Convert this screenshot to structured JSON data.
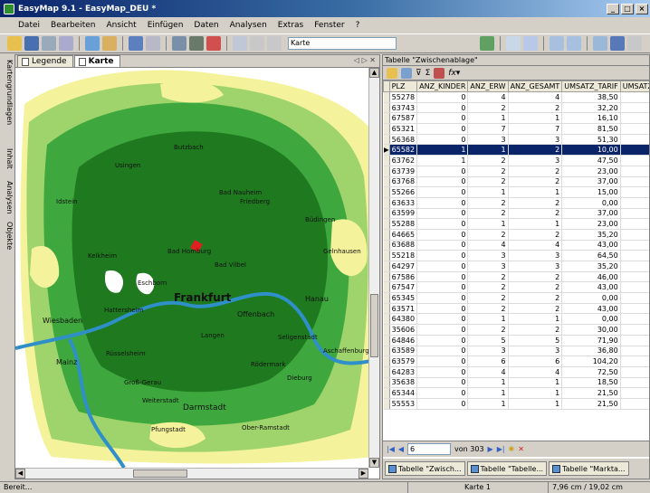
{
  "window": {
    "title": "EasyMap 9.1 - EasyMap_DEU *"
  },
  "menu": [
    "Datei",
    "Bearbeiten",
    "Ansicht",
    "Einfügen",
    "Daten",
    "Analysen",
    "Extras",
    "Fenster",
    "?"
  ],
  "toolbar": {
    "map_select": "Karte"
  },
  "left_tabs": [
    "Kartengrundlagen",
    "Inhalt",
    "Analysen",
    "Objekte"
  ],
  "map_tabs": [
    "Legende",
    "Karte"
  ],
  "map": {
    "labels": [
      "Frankfurt",
      "Offenbach",
      "Darmstadt",
      "Bad Homburg",
      "Bad Vilbel",
      "Bad Nauheim",
      "Friedberg",
      "Wiesbaden",
      "Mainz",
      "Rüsselsheim",
      "Hanau",
      "Butzbach",
      "Büdingen",
      "Eschborn",
      "Rödermark",
      "Dieburg",
      "Pfungstadt",
      "Groß-Gerau",
      "Aschaffenburg",
      "Langen",
      "Kelkheim",
      "Idstein",
      "Usingen",
      "Gelnhausen",
      "Seligenstadt",
      "Ober-Ramstadt",
      "Weiterstadt",
      "Hattersheim"
    ]
  },
  "table": {
    "panel_title": "Tabelle \"Zwischenablage\"",
    "columns": [
      "PLZ",
      "ANZ_KINDER",
      "ANZ_ERW",
      "ANZ_GESAMT",
      "UMSATZ_TARIF",
      "UMSATZ_"
    ],
    "rows": [
      [
        "55278",
        "0",
        "4",
        "4",
        "38,50"
      ],
      [
        "63743",
        "0",
        "2",
        "2",
        "32,20"
      ],
      [
        "67587",
        "0",
        "1",
        "1",
        "16,10"
      ],
      [
        "65321",
        "0",
        "7",
        "7",
        "81,50"
      ],
      [
        "56368",
        "0",
        "3",
        "3",
        "51,30"
      ],
      [
        "65582",
        "1",
        "1",
        "2",
        "10,00"
      ],
      [
        "63762",
        "1",
        "2",
        "3",
        "47,50"
      ],
      [
        "63739",
        "0",
        "2",
        "2",
        "23,00"
      ],
      [
        "63768",
        "0",
        "2",
        "2",
        "37,00"
      ],
      [
        "55266",
        "0",
        "1",
        "1",
        "15,00"
      ],
      [
        "63633",
        "0",
        "2",
        "2",
        "0,00"
      ],
      [
        "63599",
        "0",
        "2",
        "2",
        "37,00"
      ],
      [
        "55288",
        "0",
        "1",
        "1",
        "23,00"
      ],
      [
        "64665",
        "0",
        "2",
        "2",
        "35,20"
      ],
      [
        "63688",
        "0",
        "4",
        "4",
        "43,00"
      ],
      [
        "55218",
        "0",
        "3",
        "3",
        "64,50"
      ],
      [
        "64297",
        "0",
        "3",
        "3",
        "35,20"
      ],
      [
        "67586",
        "0",
        "2",
        "2",
        "46,00"
      ],
      [
        "67547",
        "0",
        "2",
        "2",
        "43,00"
      ],
      [
        "65345",
        "0",
        "2",
        "2",
        "0,00"
      ],
      [
        "63571",
        "0",
        "2",
        "2",
        "43,00"
      ],
      [
        "64380",
        "0",
        "1",
        "1",
        "0,00"
      ],
      [
        "35606",
        "0",
        "2",
        "2",
        "30,00"
      ],
      [
        "64846",
        "0",
        "5",
        "5",
        "71,90"
      ],
      [
        "63589",
        "0",
        "3",
        "3",
        "36,80"
      ],
      [
        "63579",
        "0",
        "6",
        "6",
        "104,20"
      ],
      [
        "64283",
        "0",
        "4",
        "4",
        "72,50"
      ],
      [
        "35638",
        "0",
        "1",
        "1",
        "18,50"
      ],
      [
        "65344",
        "0",
        "1",
        "1",
        "21,50"
      ],
      [
        "55553",
        "0",
        "1",
        "1",
        "21,50"
      ]
    ],
    "selected_row_index": 5,
    "nav": {
      "record": "6",
      "count_text": "von 303"
    },
    "bottom_tabs": [
      "Tabelle \"Zwisch...",
      "Tabelle \"Tabelle...",
      "Tabelle \"Markta..."
    ]
  },
  "status": {
    "left": "Bereit...",
    "middle": "Karte 1",
    "right": "7,96 cm / 19,02 cm"
  },
  "colors": {
    "dark_green": "#1f7a1f",
    "mid_green": "#3ea83e",
    "light_green": "#9ed46b",
    "pale_yellow": "#f4f29a",
    "river_blue": "#2f8fc8",
    "selection": "#0a246a"
  }
}
